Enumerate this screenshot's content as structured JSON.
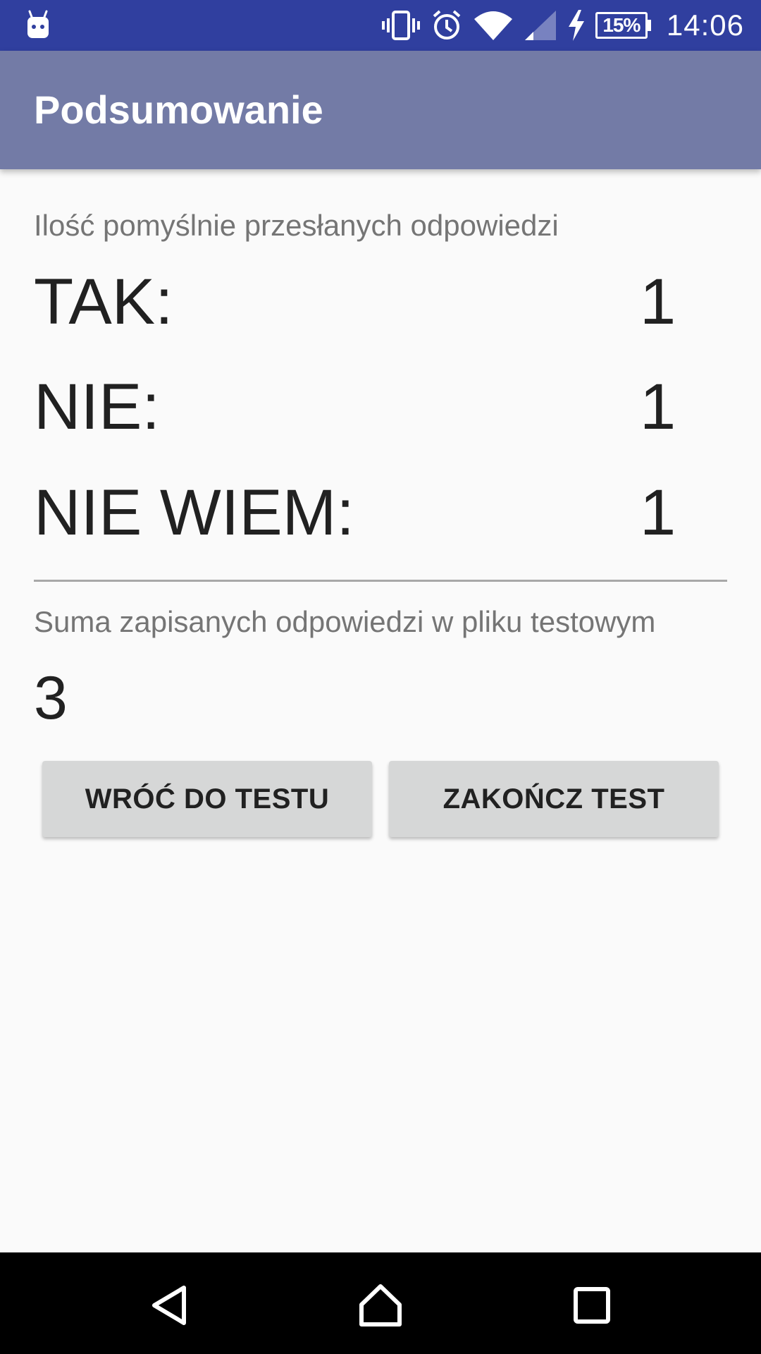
{
  "status_bar": {
    "time": "14:06",
    "battery_percent": "15%",
    "icons": [
      "android-icon",
      "vibrate-icon",
      "alarm-icon",
      "wifi-icon",
      "signal-icon",
      "charging-icon",
      "battery-icon"
    ]
  },
  "app_bar": {
    "title": "Podsumowanie"
  },
  "summary": {
    "sent_caption": "Ilość pomyślnie przesłanych odpowiedzi",
    "rows": [
      {
        "label": "TAK:",
        "value": "1"
      },
      {
        "label": "NIE:",
        "value": "1"
      },
      {
        "label": "NIE WIEM:",
        "value": "1"
      }
    ],
    "total_caption": "Suma zapisanych odpowiedzi w pliku testowym",
    "total_value": "3"
  },
  "buttons": {
    "back_label": "WRÓĆ DO TESTU",
    "finish_label": "ZAKOŃCZ TEST"
  },
  "nav_bar": {
    "icons": [
      "back-icon",
      "home-icon",
      "recents-icon"
    ]
  },
  "colors": {
    "status_bar": "#303f9f",
    "app_bar": "#737ba6",
    "background": "#fafafa",
    "button": "#d6d7d7"
  }
}
